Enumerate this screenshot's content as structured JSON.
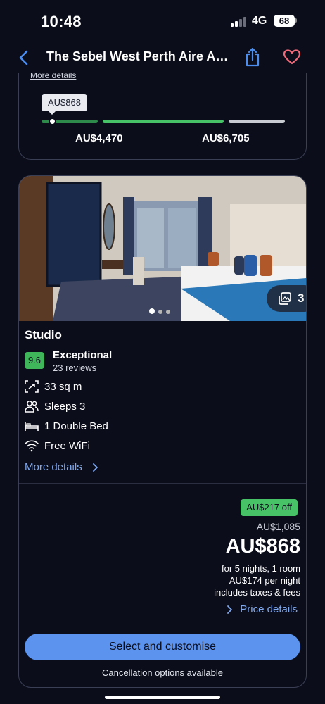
{
  "status": {
    "time": "10:48",
    "network": "4G",
    "battery": "68"
  },
  "header": {
    "title": "The Sebel West Perth Aire Apartments"
  },
  "price_graph": {
    "more_details": "More details",
    "tag": "AU$868",
    "low": "AU$4,470",
    "high": "AU$6,705"
  },
  "room": {
    "photo_count": "3",
    "title": "Studio",
    "score": "9.6",
    "rating_label": "Exceptional",
    "reviews": "23 reviews",
    "features": [
      "33 sq m",
      "Sleeps 3",
      "1 Double Bed",
      "Free WiFi"
    ],
    "more_details": "More details",
    "discount": "AU$217 off",
    "old_price": "AU$1,085",
    "price": "AU$868",
    "price_info": [
      "for 5 nights, 1 room",
      "AU$174 per night",
      "includes taxes & fees"
    ],
    "price_details": "Price details",
    "select": "Select and customise",
    "cancellation": "Cancellation options available"
  },
  "colors": {
    "accent": "#5b93ee",
    "link": "#7fa9f0",
    "green": "#47c266",
    "heart": "#f06a7a"
  }
}
